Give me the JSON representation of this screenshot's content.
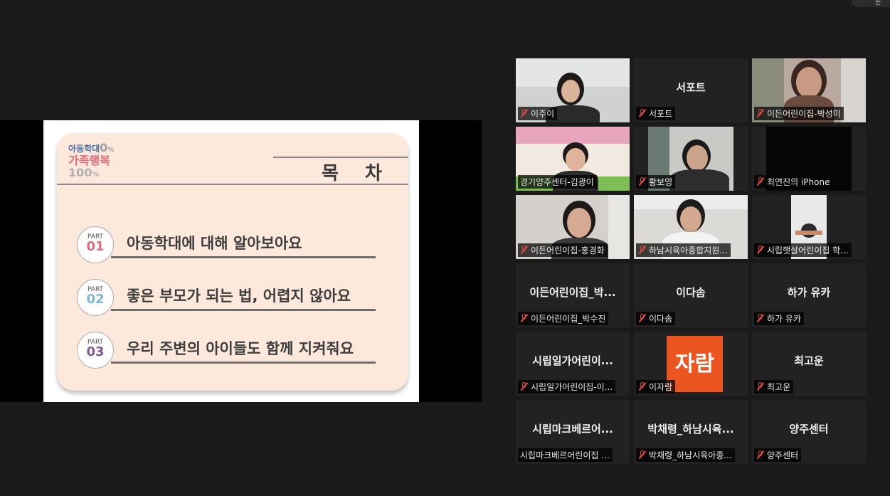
{
  "top_corner_label": "는",
  "slide": {
    "logo_line1": "아동학대",
    "logo_line1_num": "0",
    "logo_line1_unit": "%",
    "logo_line2": "가족행복",
    "logo_line3": "100",
    "logo_line3_unit": "%",
    "title": "목 차",
    "parts": [
      {
        "label": "PART",
        "num": "01",
        "color": "#e86a7a",
        "text": "아동학대에 대해 알아보아요"
      },
      {
        "label": "PART",
        "num": "02",
        "color": "#7bb7d9",
        "text": "좋은 부모가 되는 법, 어렵지 않아요"
      },
      {
        "label": "PART",
        "num": "03",
        "color": "#7a5a9c",
        "text": "우리 주변의 아이들도 함께 지켜줘요"
      }
    ]
  },
  "gallery": {
    "tiles": [
      {
        "name": "이주이",
        "center": "",
        "muted": true
      },
      {
        "name": "서포트",
        "center": "서포트",
        "muted": true
      },
      {
        "name": "이든어린이집-박성미",
        "center": "",
        "muted": true
      },
      {
        "name": "경기양주센터-김광이",
        "center": "",
        "muted": false,
        "active": true
      },
      {
        "name": "황보영",
        "center": "",
        "muted": true
      },
      {
        "name": "최연진의 iPhone",
        "center": "",
        "muted": true
      },
      {
        "name": "이든어린이집-홍경화",
        "center": "",
        "muted": true
      },
      {
        "name": "하남시육아종합지원...",
        "center": "",
        "muted": true
      },
      {
        "name": "시립햇살어린이집 학...",
        "center": "",
        "muted": true
      },
      {
        "name": "이든어린이집_박수진",
        "center": "이든어린이집_박...",
        "muted": true
      },
      {
        "name": "이다솜",
        "center": "이다솜",
        "muted": true
      },
      {
        "name": "하가 유카",
        "center": "하가 유카",
        "muted": true
      },
      {
        "name": "시립일가어린이집-이...",
        "center": "시립일가어린이...",
        "muted": true
      },
      {
        "name": "이자람",
        "center": "",
        "muted": true,
        "avatar_text": "자람"
      },
      {
        "name": "최고운",
        "center": "최고운",
        "muted": true
      },
      {
        "name": "시립마크베르어린이집 ...",
        "center": "시립마크베르어...",
        "muted": false
      },
      {
        "name": "박채령_하남시육아종...",
        "center": "박채령_하남시육...",
        "muted": true
      },
      {
        "name": "양주센터",
        "center": "양주센터",
        "muted": true
      }
    ]
  },
  "colors": {
    "background": "#1a1a1a",
    "tile": "#222222",
    "active_speaker_border": "#e3e36a",
    "mute_red": "#e74c3c"
  }
}
